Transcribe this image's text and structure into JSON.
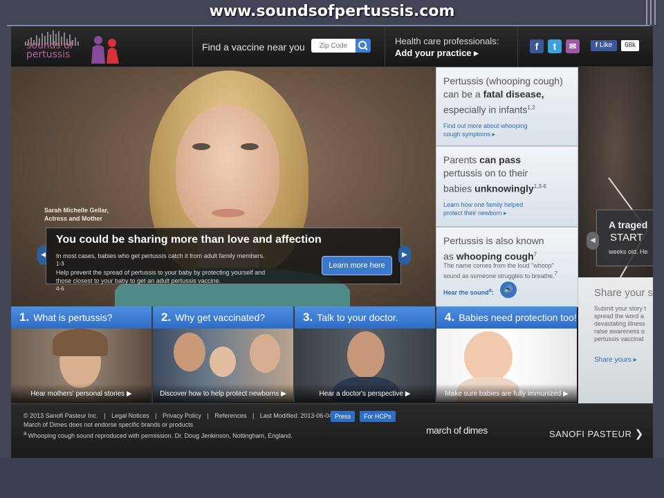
{
  "slide_title": "www.soundsofpertussis.com",
  "header": {
    "logo_line1": "sounds of",
    "logo_line2": "pertussis",
    "find_label": "Find a vaccine near you",
    "zip_placeholder": "Zip Code",
    "hcp_line1": "Health care professionals:",
    "hcp_line2": "Add your practice ▸",
    "social": {
      "facebook": "f",
      "twitter": "t",
      "email": "✉"
    },
    "like_label": "Like",
    "like_count": "68k"
  },
  "hero": {
    "caption_name": "Sarah Michelle Gellar,",
    "caption_role": "Actress and Mother",
    "callout_title": "You could be sharing more than love and affection",
    "callout_text1": "In most cases, babies who get pertussis catch it from adult family members.",
    "callout_ref1": "1-3",
    "callout_text2": "Help prevent the spread of pertussis to your baby by protecting yourself and",
    "callout_text3": "those closest to your baby to get an adult pertussis vaccine.",
    "callout_ref2": "4-6",
    "learn_btn": "Learn more here",
    "prev": "◀",
    "next": "▶"
  },
  "facts": [
    {
      "h1": "Pertussis (whooping cough)",
      "h2_pre": "can be a ",
      "h2_bold": "fatal disease,",
      "h3": "especially in infants",
      "ref": "1,2",
      "link1": "Find out more about whooping",
      "link2": "cough symptoms ▸"
    },
    {
      "h1_pre": "Parents ",
      "h1_bold": "can pass",
      "h2": "pertussis on to their",
      "h3_pre": "babies ",
      "h3_bold": "unknowingly",
      "ref": "1,3-6",
      "link1": "Learn how one family helped",
      "link2": "protect their newborn ▸"
    },
    {
      "h1": "Pertussis is also known",
      "h2_pre": "as ",
      "h2_bold": "whooping cough",
      "ref": "7",
      "small1": "The name comes from the loud \"whoop\"",
      "small2": "sound as someone struggles to breathe.",
      "small_ref": "7",
      "sound_label": "Hear the sound",
      "sound_ref": "a",
      "sound_icon": "🔊"
    }
  ],
  "side": {
    "title": "A traged",
    "start": "START",
    "text1": "N     rton",
    "text2": "weeks old. He",
    "share_title": "Share your st",
    "share_lines": [
      "Submit your story t",
      "spread the word a",
      "devastating illness",
      "raise awareness o",
      "pertussis vaccinat"
    ],
    "share_link": "Share yours ▸",
    "arrow": "◀"
  },
  "tiles": [
    {
      "num": "1.",
      "title": "What is pertussis?",
      "caption": "Hear mothers' personal stories ▶"
    },
    {
      "num": "2.",
      "title": "Why get vaccinated?",
      "caption": "Discover how to help protect newborns ▶"
    },
    {
      "num": "3.",
      "title": "Talk to your doctor.",
      "caption": "Hear a doctor's perspective ▶"
    },
    {
      "num": "4.",
      "title": "Babies need protection too!",
      "caption": "Make sure babies are fully immunized ▶"
    }
  ],
  "footer": {
    "copyright": "© 2013 Sanofi Pasteur Inc.",
    "legal": "Legal Notices",
    "privacy": "Privacy Policy",
    "references": "References",
    "modified": "Last Modified: 2013-06-04",
    "sep": "|",
    "press": "Press",
    "for_hcps": "For HCPs",
    "endorse": "March of Dimes does not endorse specific brands or products",
    "note_mark": "a",
    "note": "Whooping cough sound reproduced with permission. Dr. Doug Jenkinson, Nottingham, England.",
    "march_of_dimes": "march of dimes",
    "sanofi": "SANOFI PASTEUR"
  },
  "colors": {
    "accent_blue": "#2e6cc4",
    "logo_pink": "#b5649a",
    "background": "#434358"
  }
}
